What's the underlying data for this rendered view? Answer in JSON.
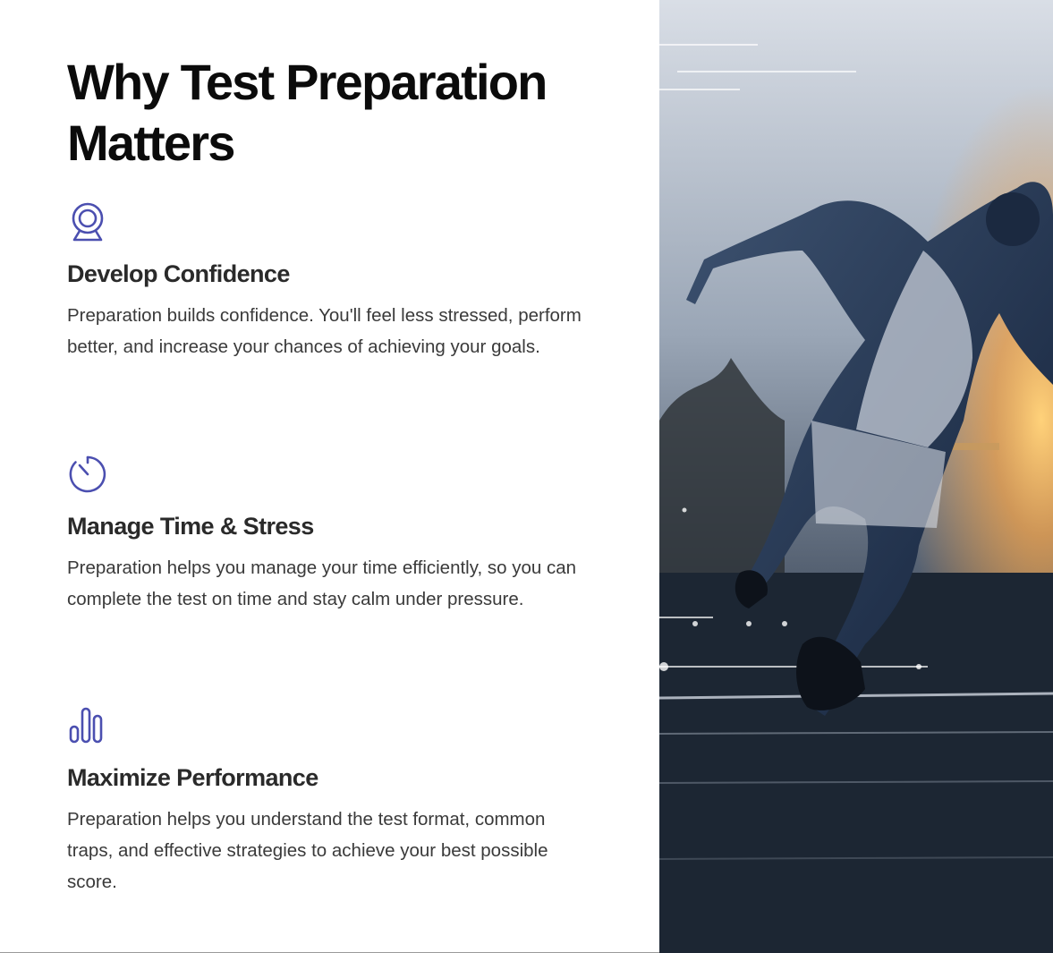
{
  "section": {
    "title": "Why Test Preparation Matters"
  },
  "features": [
    {
      "icon": "webcam-icon",
      "heading": "Develop Confidence",
      "description": "Preparation builds confidence. You'll feel less stressed, perform better, and increase your chances of achieving your goals."
    },
    {
      "icon": "timer-icon",
      "heading": "Manage Time & Stress",
      "description": "Preparation helps you manage your time efficiently, so you can complete the test on time and stay calm under pressure."
    },
    {
      "icon": "bar-chart-icon",
      "heading": "Maximize Performance",
      "description": "Preparation helps you understand the test format, common traps, and effective strategies to achieve your best possible score."
    }
  ],
  "colors": {
    "icon_accent": "#4b4fb0",
    "title": "#0b0b0b",
    "heading": "#2a2a2a",
    "body": "#3a3a3a"
  },
  "hero_image": {
    "alt": "sprinter-running-on-track"
  }
}
